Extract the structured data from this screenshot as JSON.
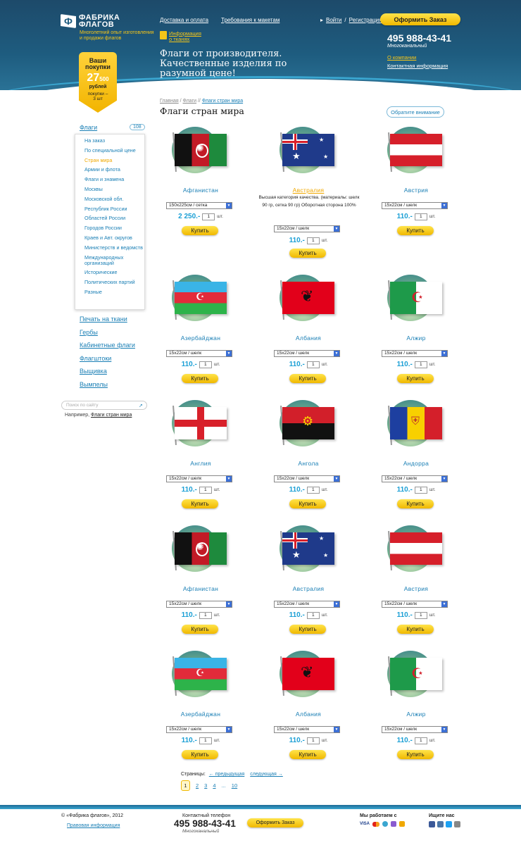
{
  "header": {
    "logo_text": "ФАБРИКА ФЛАГОВ",
    "tagline": "Многолетний опыт изготовления и продажи флагов",
    "delivery": "Доставка и оплата",
    "requirements": "Требования к макетам",
    "info_fabrics": "Информация о тканях",
    "slogan": "Флаги от производителя. Качественные изделия по разумной цене!",
    "login": "Войти",
    "register": "Регистрация",
    "order_button": "Оформить Заказ",
    "phone": "495 988-43-41",
    "phone_sub": "Многоканальный",
    "about": "О компании",
    "contacts": "Контактная информация"
  },
  "cart": {
    "title": "Ваши покупки",
    "amount": "27",
    "amount_small": "500",
    "currency": "рублей",
    "items": "покупки – 3 шт"
  },
  "sidebar": {
    "category": "Флаги",
    "count": "108",
    "subitems": [
      "На заказ",
      "По специальной цене",
      "Стран мира",
      "Армии и флота",
      "Флаги и знамена",
      "Москвы",
      "Московской обл.",
      "Республик России",
      "Областей России",
      "Городов России",
      "Краев и Авт. округов",
      "Министерств и ведомств",
      "Международных организаций",
      "Исторические",
      "Политических партий",
      "Разные"
    ],
    "nav": [
      "Печать на ткани",
      "Гербы",
      "Кабинетные флаги",
      "Флагштоки",
      "Выщивка",
      "Вымпелы"
    ],
    "search_placeholder": "Поиск по сайту",
    "search_example_label": "Например,",
    "search_example": "Флаги стран мира"
  },
  "content": {
    "breadcrumbs": [
      "Главная",
      "Флаги",
      "Флаги стран мира"
    ],
    "title": "Флаги стран мира",
    "attention": "Обратите внимание",
    "unit": "шт.",
    "buy": "Купить",
    "hover_desc": "Высшая категория качества. (материалы: шелк 90 гр, сетка 90 гр) Оборотная сторона 100%",
    "products": [
      {
        "name": "Афганистан",
        "size": "150х225см / сетка",
        "price": "2 250.-",
        "qty": "1",
        "flag": "af"
      },
      {
        "name": "Австралия",
        "size": "15х22см / шелк",
        "price": "110.-",
        "qty": "1",
        "flag": "au"
      },
      {
        "name": "Австрия",
        "size": "15х22см / шелк",
        "price": "110.-",
        "qty": "1",
        "flag": "at"
      },
      {
        "name": "Азербайджан",
        "size": "15х22см / шелк",
        "price": "110.-",
        "qty": "1",
        "flag": "az"
      },
      {
        "name": "Албания",
        "size": "15х22см / шелк",
        "price": "110.-",
        "qty": "1",
        "flag": "al"
      },
      {
        "name": "Алжир",
        "size": "15х22см / шелк",
        "price": "110.-",
        "qty": "1",
        "flag": "dz"
      },
      {
        "name": "Англия",
        "size": "15х22см / шелк",
        "price": "110.-",
        "qty": "1",
        "flag": "en"
      },
      {
        "name": "Ангола",
        "size": "15х22см / шелк",
        "price": "110.-",
        "qty": "1",
        "flag": "ao"
      },
      {
        "name": "Андорра",
        "size": "15х22см / шелк",
        "price": "110.-",
        "qty": "1",
        "flag": "ad"
      },
      {
        "name": "Афганистан",
        "size": "15х22см / шелк",
        "price": "110.-",
        "qty": "1",
        "flag": "af"
      },
      {
        "name": "Австралия",
        "size": "15х22см / шелк",
        "price": "110.-",
        "qty": "1",
        "flag": "au"
      },
      {
        "name": "Австрия",
        "size": "15х22см / шелк",
        "price": "110.-",
        "qty": "1",
        "flag": "at"
      },
      {
        "name": "Азербайджан",
        "size": "15х22см / шелк",
        "price": "110.-",
        "qty": "1",
        "flag": "az"
      },
      {
        "name": "Албания",
        "size": "15х22см / шелк",
        "price": "110.-",
        "qty": "1",
        "flag": "al"
      },
      {
        "name": "Алжир",
        "size": "15х22см / шелк",
        "price": "110.-",
        "qty": "1",
        "flag": "dz"
      }
    ]
  },
  "pager": {
    "label": "Страницы:",
    "prev": "← предыдущая",
    "next": "следующая →",
    "pages": [
      "1",
      "2",
      "3",
      "4",
      "...",
      "10"
    ]
  },
  "footer": {
    "copyright": "© «Фабрика флагов», 2012",
    "legal": "Правовая информация",
    "phone_label": "Контактный телефон",
    "phone": "495 988-43-41",
    "phone_sub": "Многоканальный",
    "order_button": "Оформить Заказ",
    "pay_title": "Мы работаем с",
    "pay_visa": "VISA",
    "social_title": "Ищите нас"
  },
  "colors": {
    "accent": "#1a7fb5",
    "brand_dark": "#1e5c7f",
    "yellow": "#f5c518"
  }
}
